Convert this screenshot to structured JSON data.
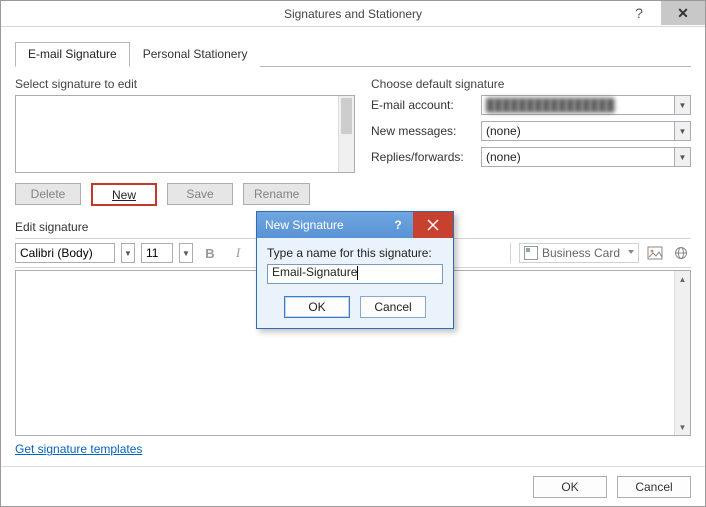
{
  "window": {
    "title": "Signatures and Stationery",
    "help": "?",
    "close": "✕"
  },
  "tabs": {
    "email": "E-mail Signature",
    "stationery": "Personal Stationery"
  },
  "left": {
    "section_label": "Select signature to edit",
    "delete": "Delete",
    "new": "New",
    "save": "Save",
    "rename": "Rename"
  },
  "right": {
    "section_label": "Choose default signature",
    "account_label": "E-mail account:",
    "account_value": "████████████████",
    "newmsg_label": "New messages:",
    "newmsg_value": "(none)",
    "replies_label": "Replies/forwards:",
    "replies_value": "(none)"
  },
  "edit": {
    "label": "Edit signature",
    "font": "Calibri (Body)",
    "size": "11",
    "bold": "B",
    "italic": "I",
    "bizcard": "Business Card"
  },
  "link": "Get signature templates",
  "footer": {
    "ok": "OK",
    "cancel": "Cancel"
  },
  "modal": {
    "title": "New Signature",
    "help": "?",
    "close": "✕",
    "label": "Type a name for this signature:",
    "value": "Email-Signature",
    "ok": "OK",
    "cancel": "Cancel"
  }
}
